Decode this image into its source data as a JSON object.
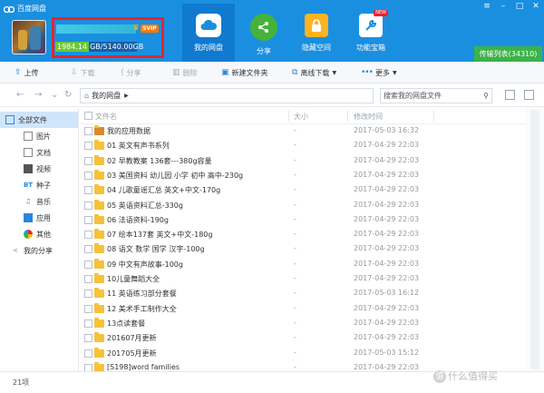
{
  "app": {
    "title": "百度网盘"
  },
  "user": {
    "badge": "SVIP",
    "quota_used": "1984.14",
    "quota_total": "GB/5140.00GB"
  },
  "nav": [
    {
      "label": "我的网盘",
      "icon": "cloud-icon"
    },
    {
      "label": "分享",
      "icon": "share-icon"
    },
    {
      "label": "隐藏空间",
      "icon": "lock-icon"
    },
    {
      "label": "功能宝箱",
      "icon": "toolbox-icon",
      "tag": "NEW"
    }
  ],
  "transfer": {
    "label": "传输列表(34310)"
  },
  "toolbar": {
    "upload": "上传",
    "download": "下载",
    "share": "分享",
    "delete": "删除",
    "new_folder": "新建文件夹",
    "offline": "离线下载",
    "more": "更多"
  },
  "path": {
    "current": "我的网盘"
  },
  "search": {
    "placeholder": "搜索我的网盘文件"
  },
  "sidebar": [
    {
      "label": "全部文件"
    },
    {
      "label": "图片"
    },
    {
      "label": "文档"
    },
    {
      "label": "视频"
    },
    {
      "label": "种子"
    },
    {
      "label": "音乐"
    },
    {
      "label": "应用"
    },
    {
      "label": "其他"
    },
    {
      "label": "我的分享"
    }
  ],
  "columns": {
    "name": "文件名",
    "size": "大小",
    "date": "修改时间"
  },
  "files": [
    {
      "name": "我的应用数据",
      "size": "-",
      "date": "2017-05-03 16:32"
    },
    {
      "name": "01 英文有声书系列",
      "size": "-",
      "date": "2017-04-29 22:03"
    },
    {
      "name": "02 早教教案 136套---380g容量",
      "size": "-",
      "date": "2017-04-29 22:03"
    },
    {
      "name": "03 美国资料 幼儿园 小学 初中 高中-230g",
      "size": "-",
      "date": "2017-04-29 22:03"
    },
    {
      "name": "04 儿歌童谣汇总 英文+中文-170g",
      "size": "-",
      "date": "2017-04-29 22:03"
    },
    {
      "name": "05 英语资料汇总-330g",
      "size": "-",
      "date": "2017-04-29 22:03"
    },
    {
      "name": "06 法语资料-190g",
      "size": "-",
      "date": "2017-04-29 22:03"
    },
    {
      "name": "07 绘本137套 英文+中文-180g",
      "size": "-",
      "date": "2017-04-29 22:03"
    },
    {
      "name": "08 语文 数学 国学 汉字-100g",
      "size": "-",
      "date": "2017-04-29 22:03"
    },
    {
      "name": "09 中文有声故事-100g",
      "size": "-",
      "date": "2017-04-29 22:03"
    },
    {
      "name": "10儿童舞蹈大全",
      "size": "-",
      "date": "2017-04-29 22:03"
    },
    {
      "name": "11 英语练习部分套餐",
      "size": "-",
      "date": "2017-05-03 16:12"
    },
    {
      "name": "12 美术手工制作大全",
      "size": "-",
      "date": "2017-04-29 22:03"
    },
    {
      "name": "13点读套餐",
      "size": "-",
      "date": "2017-04-29 22:03"
    },
    {
      "name": "201607月更新",
      "size": "-",
      "date": "2017-04-29 22:03"
    },
    {
      "name": "201705月更新",
      "size": "-",
      "date": "2017-05-03 15:12"
    },
    {
      "name": "[S198]word families",
      "size": "-",
      "date": "2017-04-29 22:03"
    }
  ],
  "status": {
    "count": "21项"
  },
  "watermark": {
    "text": "什么值得买",
    "glyph": "值"
  }
}
